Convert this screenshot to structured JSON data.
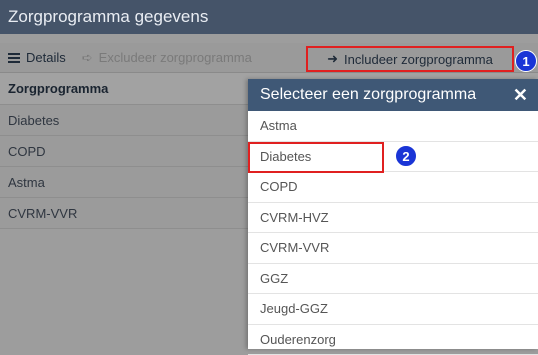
{
  "window": {
    "title": "Zorgprogramma gegevens"
  },
  "toolbar": {
    "details_label": "Details",
    "exclude_label": "Excludeer zorgprogramma",
    "include_label": "Includeer zorgprogramma"
  },
  "list": {
    "header": "Zorgprogramma",
    "items": [
      "Diabetes",
      "COPD",
      "Astma",
      "CVRM-VVR"
    ]
  },
  "dialog": {
    "title": "Selecteer een zorgprogramma",
    "close": "✕",
    "options": [
      "Astma",
      "Diabetes",
      "COPD",
      "CVRM-HVZ",
      "CVRM-VVR",
      "GGZ",
      "Jeugd-GGZ",
      "Ouderenzorg"
    ]
  },
  "badges": {
    "first": "1",
    "second": "2"
  },
  "colors": {
    "title_bar": "#455469",
    "dialog_header": "#3f5876",
    "highlight": "#e02020",
    "badge": "#1a35d6"
  }
}
